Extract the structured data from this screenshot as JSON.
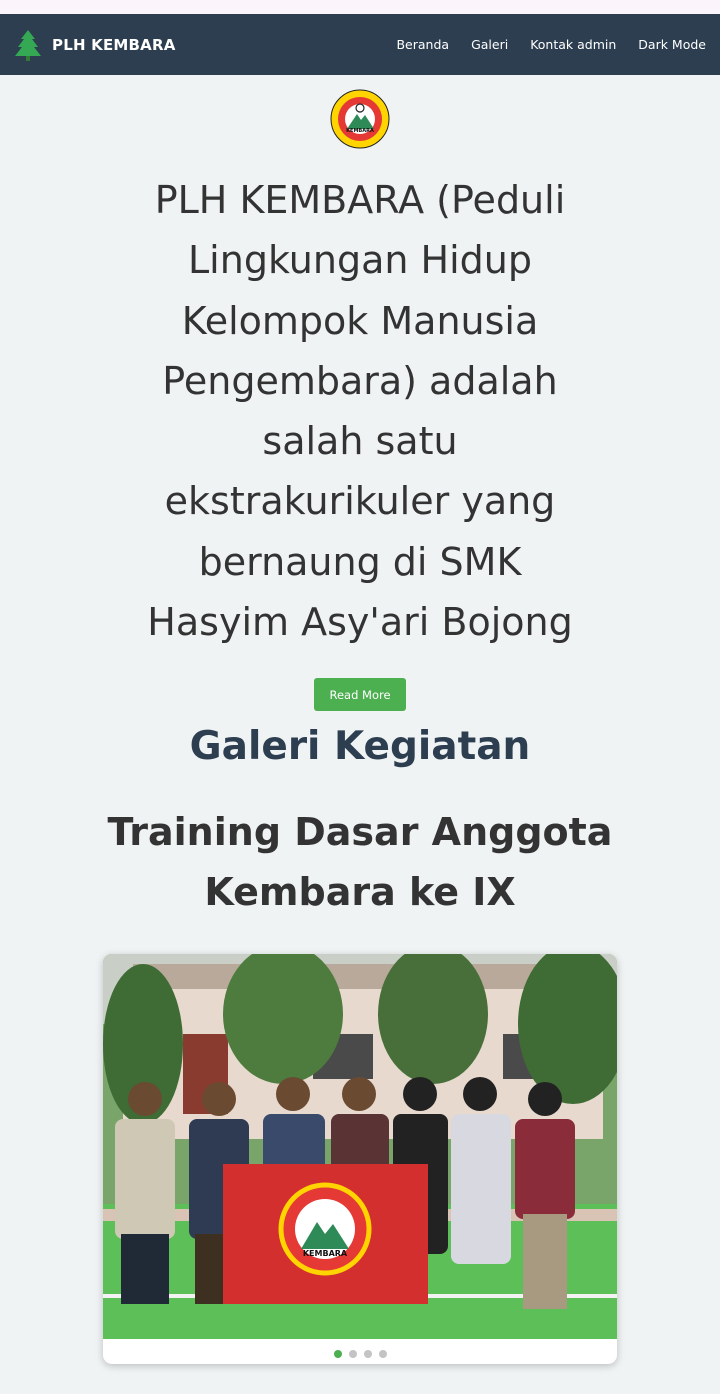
{
  "navbar": {
    "brand": "PLH KEMBARA",
    "links": [
      "Beranda",
      "Galeri",
      "Kontak admin",
      "Dark Mode"
    ]
  },
  "hero": {
    "logo_text": "KEMBARA",
    "intro": "PLH KEMBARA (Peduli Lingkungan Hidup Kelompok Manusia Pengembara) adalah salah satu ekstrakurikuler yang bernaung di SMK Hasyim Asy'ari Bojong",
    "read_more": "Read More"
  },
  "gallery": {
    "title": "Galeri Kegiatan",
    "event_title": "Training Dasar Anggota Kembara ke IX",
    "flag_text": "KEMBARA",
    "slide_count": 4,
    "active_slide": 0
  },
  "colors": {
    "navbar": "#2c3e50",
    "accent": "#4caf50",
    "page_bg": "#eff3f4",
    "heading": "#2c3e50"
  },
  "icons": {
    "brand": "tree-icon"
  }
}
